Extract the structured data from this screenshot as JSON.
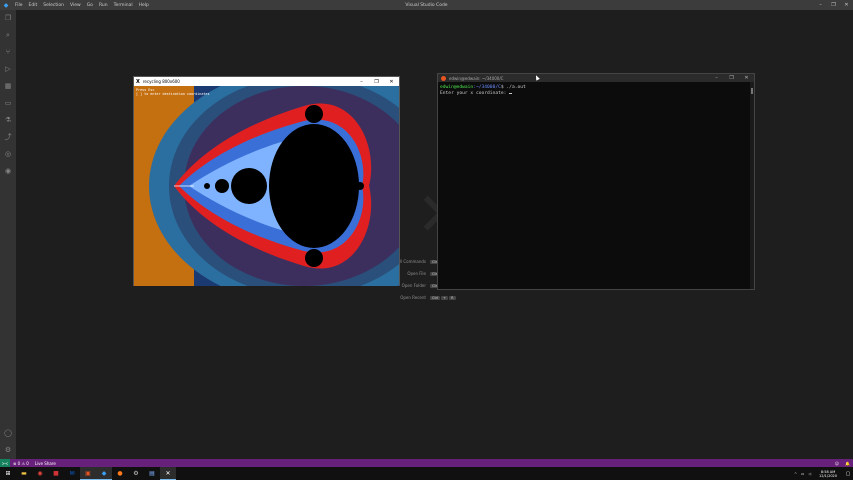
{
  "vscode": {
    "title": "Visual Studio Code",
    "menu": [
      "File",
      "Edit",
      "Selection",
      "View",
      "Go",
      "Run",
      "Terminal",
      "Help"
    ],
    "window_controls": [
      "–",
      "❐",
      "✕"
    ]
  },
  "welcome": {
    "shortcuts": [
      {
        "label": "All Commands",
        "keys": [
          "Ctrl",
          "+",
          "Shift",
          "+",
          "P"
        ]
      },
      {
        "label": "Open File",
        "keys": [
          "Ctrl",
          "+",
          "O"
        ]
      },
      {
        "label": "Open Folder",
        "keys": [
          "Ctrl",
          "+",
          "K",
          "Ctrl",
          "+",
          "O"
        ]
      },
      {
        "label": "Open Recent",
        "keys": [
          "Ctrl",
          "+",
          "R"
        ]
      }
    ]
  },
  "fractal_window": {
    "title": "recycling 800x600",
    "overlay_line1": "Press Esc",
    "overlay_line2": "[ ] to enter destination coordinates",
    "controls": [
      "–",
      "❐",
      "✕"
    ]
  },
  "terminal": {
    "title": "edwin@edwain: ~/34000/C",
    "prompt_user": "edwin@edwain",
    "prompt_path": ":~/34000/C",
    "prompt_cmd": "$ ./a.out",
    "output_line": "Enter your x coordinate: ",
    "controls": [
      "–",
      "❐",
      "✕"
    ]
  },
  "statusbar": {
    "remote": "><",
    "problems": "⊗ 0 ⚠ 0",
    "live_share": "Live Share",
    "bell": "🔔",
    "feedback": "☺"
  },
  "taskbar": {
    "time": "8:58 AM",
    "date": "12/1/2020"
  },
  "colors": {
    "statusbar": "#68217a",
    "fractal_outer": "#2b5f8c",
    "fractal_orange": "#c46f10"
  }
}
